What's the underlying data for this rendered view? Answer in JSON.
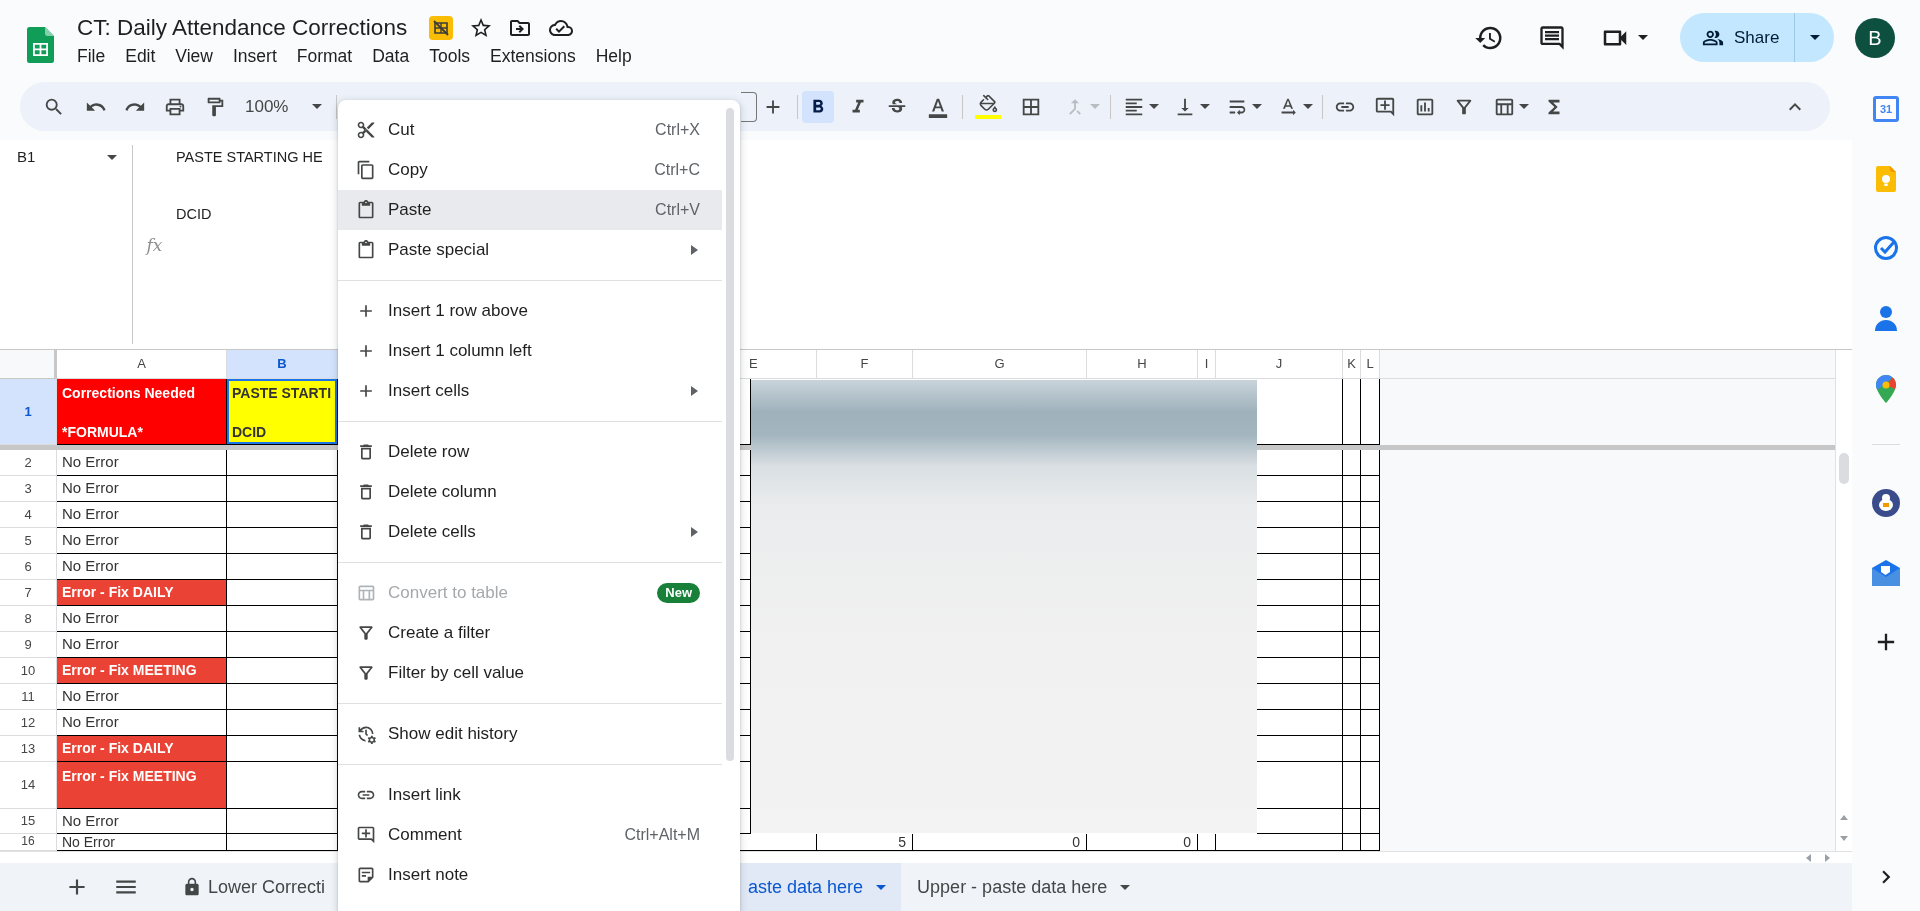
{
  "document": {
    "title": "CT: Daily Attendance Corrections"
  },
  "menu_bar": [
    "File",
    "Edit",
    "View",
    "Insert",
    "Format",
    "Data",
    "Tools",
    "Extensions",
    "Help"
  ],
  "account": {
    "share": "Share",
    "avatar": "B"
  },
  "toolbar": {
    "zoom": "100%",
    "bold": true,
    "italic": false,
    "strikethrough": false,
    "merge_disabled": true
  },
  "side_panel": {
    "calendar_day": "31"
  },
  "formula_bar": {
    "cell": "B1",
    "label": "fx",
    "lines": [
      "PASTE STARTING HE",
      "DCID"
    ]
  },
  "grid": {
    "columns": [
      {
        "label": "A",
        "selected": false
      },
      {
        "label": "B",
        "selected": true
      },
      {
        "label": "E",
        "selected": false
      },
      {
        "label": "F",
        "selected": false
      },
      {
        "label": "G",
        "selected": false
      },
      {
        "label": "H",
        "selected": false
      },
      {
        "label": "I",
        "selected": false
      },
      {
        "label": "J",
        "selected": false
      },
      {
        "label": "K",
        "selected": false
      },
      {
        "label": "L",
        "selected": false
      }
    ],
    "rows": [
      {
        "number": "1",
        "selected": true,
        "a": {
          "kind": "header",
          "lines": [
            "Corrections Needed",
            "*FORMULA*"
          ],
          "color": "#ff0000",
          "selected": false
        },
        "b": {
          "kind": "header",
          "lines": [
            "PASTE STARTI",
            "DCID"
          ],
          "color": "#ffff00",
          "selected": true
        }
      },
      {
        "number": "2",
        "selected": false,
        "a": {
          "kind": "plain",
          "text": "No Error",
          "selected": false
        }
      },
      {
        "number": "3",
        "selected": false,
        "a": {
          "kind": "plain",
          "text": "No Error",
          "selected": false
        }
      },
      {
        "number": "4",
        "selected": false,
        "a": {
          "kind": "plain",
          "text": "No Error",
          "selected": false
        }
      },
      {
        "number": "5",
        "selected": false,
        "a": {
          "kind": "plain",
          "text": "No Error",
          "selected": false
        }
      },
      {
        "number": "6",
        "selected": false,
        "a": {
          "kind": "plain",
          "text": "No Error",
          "selected": false
        }
      },
      {
        "number": "7",
        "selected": false,
        "a": {
          "kind": "error",
          "text": "Error - Fix DAILY",
          "color": "#ea4335",
          "selected": false
        }
      },
      {
        "number": "8",
        "selected": false,
        "a": {
          "kind": "plain",
          "text": "No Error",
          "selected": false
        }
      },
      {
        "number": "9",
        "selected": false,
        "a": {
          "kind": "plain",
          "text": "No Error",
          "selected": false
        }
      },
      {
        "number": "10",
        "selected": false,
        "a": {
          "kind": "error",
          "text": "Error - Fix MEETING",
          "color": "#ea4335",
          "selected": false
        }
      },
      {
        "number": "11",
        "selected": false,
        "a": {
          "kind": "plain",
          "text": "No Error",
          "selected": false
        }
      },
      {
        "number": "12",
        "selected": false,
        "a": {
          "kind": "plain",
          "text": "No Error",
          "selected": false
        }
      },
      {
        "number": "13",
        "selected": false,
        "a": {
          "kind": "error",
          "text": "Error - Fix DAILY",
          "color": "#ea4335",
          "selected": false
        }
      },
      {
        "number": "14",
        "selected": false,
        "a": {
          "kind": "error",
          "text": "Error - Fix MEETING",
          "color": "#ea4335",
          "selected": false
        }
      },
      {
        "number": "15",
        "selected": false,
        "a": {
          "kind": "plain",
          "text": "No Error",
          "selected": false
        }
      },
      {
        "number": "16",
        "selected": false,
        "a": {
          "kind": "plain",
          "text": "No Error",
          "selected": false
        },
        "f": {
          "kind": "number",
          "text": "5",
          "selected": false
        },
        "g": {
          "kind": "number",
          "text": "0",
          "selected": false
        },
        "h": {
          "kind": "number",
          "text": "0",
          "selected": false
        }
      }
    ]
  },
  "context_menu": {
    "sections": [
      [
        {
          "label": "Cut",
          "shortcut": "Ctrl+X",
          "selected": false,
          "disabled": false,
          "submenu": false
        },
        {
          "label": "Copy",
          "shortcut": "Ctrl+C",
          "selected": false,
          "disabled": false,
          "submenu": false
        },
        {
          "label": "Paste",
          "shortcut": "Ctrl+V",
          "selected": true,
          "disabled": false,
          "submenu": false
        },
        {
          "label": "Paste special",
          "selected": false,
          "disabled": false,
          "submenu": true
        }
      ],
      [
        {
          "label": "Insert 1 row above",
          "selected": false,
          "disabled": false,
          "submenu": false
        },
        {
          "label": "Insert 1 column left",
          "selected": false,
          "disabled": false,
          "submenu": false
        },
        {
          "label": "Insert cells",
          "selected": false,
          "disabled": false,
          "submenu": true
        }
      ],
      [
        {
          "label": "Delete row",
          "selected": false,
          "disabled": false,
          "submenu": false
        },
        {
          "label": "Delete column",
          "selected": false,
          "disabled": false,
          "submenu": false
        },
        {
          "label": "Delete cells",
          "selected": false,
          "disabled": false,
          "submenu": true
        }
      ],
      [
        {
          "label": "Convert to table",
          "badge": "New",
          "selected": false,
          "disabled": true,
          "submenu": false
        },
        {
          "label": "Create a filter",
          "selected": false,
          "disabled": false,
          "submenu": false
        },
        {
          "label": "Filter by cell value",
          "selected": false,
          "disabled": false,
          "submenu": false
        }
      ],
      [
        {
          "label": "Show edit history",
          "selected": false,
          "disabled": false,
          "submenu": false
        }
      ],
      [
        {
          "label": "Insert link",
          "selected": false,
          "disabled": false,
          "submenu": false
        },
        {
          "label": "Comment",
          "shortcut": "Ctrl+Alt+M",
          "selected": false,
          "disabled": false,
          "submenu": false
        },
        {
          "label": "Insert note",
          "selected": false,
          "disabled": false,
          "submenu": false
        }
      ]
    ]
  },
  "sheet_tabs": [
    {
      "label": "Lower Correcti",
      "locked": true,
      "caret": false,
      "selected": false
    },
    {
      "label": "aste data here",
      "locked": false,
      "caret": true,
      "selected": true
    },
    {
      "label": "Upper - paste data here",
      "locked": false,
      "caret": true,
      "selected": false
    }
  ]
}
